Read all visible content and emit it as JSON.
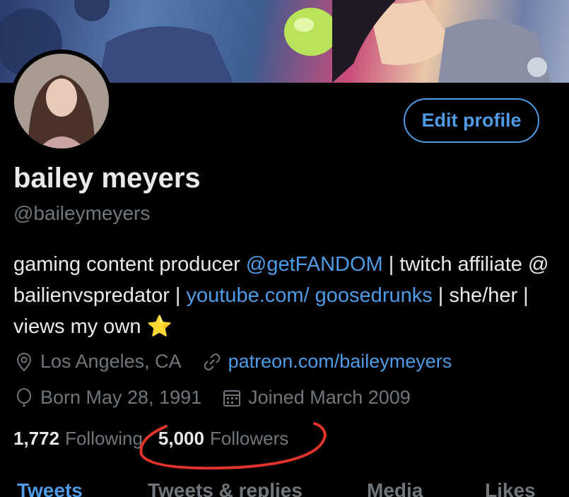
{
  "profile": {
    "name": "bailey meyers",
    "handle": "@baileymeyers",
    "edit_label": "Edit profile",
    "bio": {
      "part1": "gaming content producer ",
      "mention": "@getFANDOM",
      "part2": " | twitch affiliate @ bailienvspredator | ",
      "link": "youtube.com/ goosedrunks",
      "part3": " | she/her | views my own ",
      "emoji": "⭐"
    },
    "location": "Los Angeles, CA",
    "website": "patreon.com/baileymeyers",
    "birthday": "Born May 28, 1991",
    "joined": "Joined March 2009"
  },
  "stats": {
    "following_count": "1,772",
    "following_label": "Following",
    "followers_count": "5,000",
    "followers_label": "Followers"
  },
  "tabs": [
    "Tweets",
    "Tweets & replies",
    "Media",
    "Likes"
  ],
  "colors": {
    "accent": "#4f9be5",
    "annotation": "#e0332b"
  }
}
